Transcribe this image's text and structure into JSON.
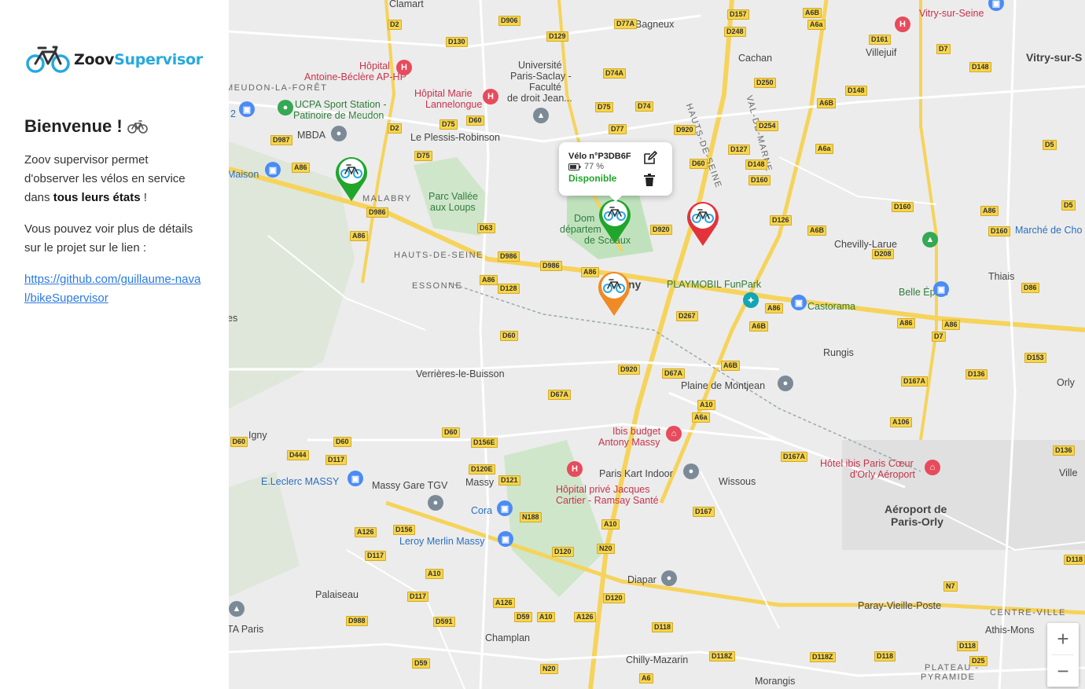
{
  "sidebar": {
    "logo_prefix": "Zoov",
    "logo_suffix": "Supervisor",
    "title": "Bienvenue !",
    "desc_part1": "Zoov supervisor permet d'observer les vélos en service dans ",
    "desc_bold": "tous leurs états",
    "desc_part2": " !",
    "desc2": "Vous pouvez voir plus de détails sur le projet sur le lien :",
    "link": "https://github.com/guillaume-naval/bikeSupervisor"
  },
  "popup": {
    "title": "Vélo n°P3DB6F",
    "battery": "77 %",
    "status": "Disponible"
  },
  "colors": {
    "available": "#21a52b",
    "warning": "#f08a24",
    "error": "#e2333a",
    "brand": "#27a8e0"
  },
  "markers": [
    {
      "status": "green"
    },
    {
      "status": "green"
    },
    {
      "status": "red"
    },
    {
      "status": "orange"
    }
  ],
  "zoom": {
    "in": "+",
    "out": "−"
  },
  "map_labels": {
    "clamart": "Clamart",
    "bagneux": "Bagneux",
    "cachan": "Cachan",
    "villejuif": "Villejuif",
    "vitry": "Vitry-sur-Seine",
    "vitry2": "Vitry-sur-S",
    "meudon": "MEUDON-LA-FORÊT",
    "hopital1": "Hôpital",
    "hopital1b": "Antoine-Béclère AP-HP",
    "hopital2": "Hôpital Marie",
    "hopital2b": "Lannelongue",
    "univ1": "Université",
    "univ2": "Paris-Saclay -",
    "univ3": "Faculté",
    "univ4": "de droit Jean...",
    "ucpa1": "UCPA Sport Station -",
    "ucpa2": "Patinoire de Meudon",
    "mbda": "MBDA",
    "plessis": "Le Plessis-Robinson",
    "maison": "Maison",
    "malabry": "MALABRY",
    "parc1": "Parc Vallée",
    "parc2": "aux Loups",
    "domaine1": "Dom",
    "domaine2": "départem",
    "domaine3": "de Sceaux",
    "antony": "ny",
    "hauts": "HAUTS-DE-SEINE",
    "essonne": "ESSONNE",
    "valmarne": "VAL-DE-MARNE",
    "chevilly": "Chevilly-Larue",
    "playmobil": "PLAYMOBIL FunPark",
    "castorama": "Castorama",
    "belle": "Belle Épine",
    "thiais": "Thiais",
    "marche": "Marché de Cho",
    "rungis": "Rungis",
    "verrieres": "Verrières-le-Buisson",
    "plaine": "Plaine de Montjean",
    "igny": "Igny",
    "ibis1": "Ibis budget",
    "ibis2": "Antony Massy",
    "hotel1": "Hôtel ibis Paris Cœur",
    "hotel2": "d'Orly Aéroport",
    "leclerc": "E.Leclerc MASSY",
    "massytgv": "Massy Gare TGV",
    "massy": "Massy",
    "cora": "Cora",
    "leroy": "Leroy Merlin Massy",
    "hp1": "Hôpital privé Jacques",
    "hp2": "Cartier - Ramsay Santé",
    "kart": "Paris Kart Indoor",
    "wissous": "Wissous",
    "aero1": "Aéroport de",
    "aero2": "Paris-Orly",
    "palaiseau": "Palaiseau",
    "diapar": "Diapar",
    "paray": "Paray-Vieille-Poste",
    "centre": "CENTRE-VILLE",
    "athis": "Athis-Mons",
    "champlan": "Champlan",
    "chilly": "Chilly-Mazarin",
    "morangis": "Morangis",
    "plateau1": "PLATEAU -",
    "plateau2": "PYRAMIDE",
    "tparis": "TA Paris",
    "orly": "Orly",
    "ville": "Ville",
    "es": "es",
    "num2": "2"
  }
}
